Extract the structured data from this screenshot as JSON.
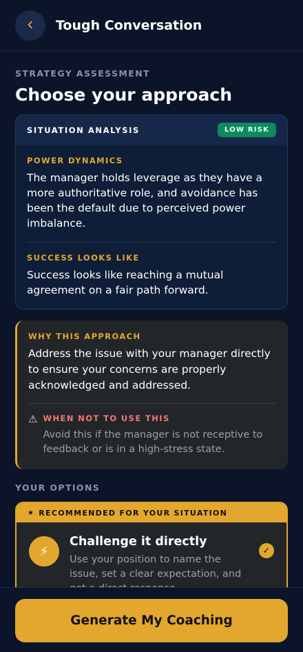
{
  "header": {
    "back_icon": "chevron-left-icon",
    "title": "Tough Conversation"
  },
  "strategy": {
    "eyebrow": "STRATEGY ASSESSMENT",
    "title": "Choose your approach"
  },
  "situation": {
    "header_label": "SITUATION ANALYSIS",
    "risk_badge": "LOW RISK",
    "power_label": "POWER DYNAMICS",
    "power_text": "The manager holds leverage as they have a more authoritative role, and avoidance has been the default due to perceived power imbalance.",
    "success_label": "SUCCESS LOOKS LIKE",
    "success_text": "Success looks like reaching a mutual agreement on a fair path forward."
  },
  "why": {
    "label": "WHY THIS APPROACH",
    "text": "Address the issue with your manager directly to ensure your concerns are properly acknowledged and addressed.",
    "when_not_label": "WHEN NOT TO USE THIS",
    "when_not_text": "Avoid this if the manager is not receptive to feedback or is in a high-stress state.",
    "warning_icon": "warning-icon"
  },
  "options": {
    "label": "YOUR OPTIONS",
    "recommended_label": "RECOMMENDED FOR YOUR SITUATION",
    "items": [
      {
        "icon": "lightning-icon",
        "title": "Challenge it directly",
        "description": "Use your position to name the issue, set a clear expectation, and get a direct response.",
        "selected": true
      }
    ]
  },
  "footer": {
    "cta_label": "Generate My Coaching"
  },
  "colors": {
    "background": "#0b1428",
    "accent": "#e3a72f",
    "risk_green": "#0f8a5f",
    "warning_red": "#f07a6f"
  }
}
